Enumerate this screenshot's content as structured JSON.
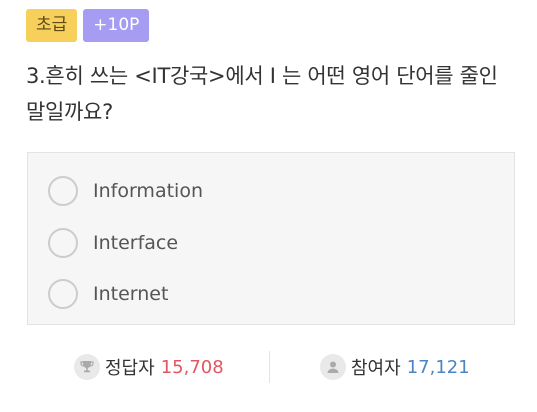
{
  "badges": {
    "level": "초급",
    "points": "+10P"
  },
  "question": {
    "text": "3.흔히 쓰는 <IT강국>에서 I 는 어떤 영어 단어를 줄인 말일까요?"
  },
  "options": [
    {
      "label": "Information",
      "selected": false
    },
    {
      "label": "Interface",
      "selected": false
    },
    {
      "label": "Internet",
      "selected": false
    }
  ],
  "stats": {
    "correct_label": "정답자",
    "correct_count": "15,708",
    "participants_label": "참여자",
    "participants_count": "17,121"
  },
  "colors": {
    "level_badge": "#f7cf5b",
    "points_badge": "#a69cf2",
    "correct_count": "#e2575e",
    "participants_count": "#4a84c5"
  },
  "icons": {
    "correct": "trophy-icon",
    "participants": "person-icon"
  }
}
